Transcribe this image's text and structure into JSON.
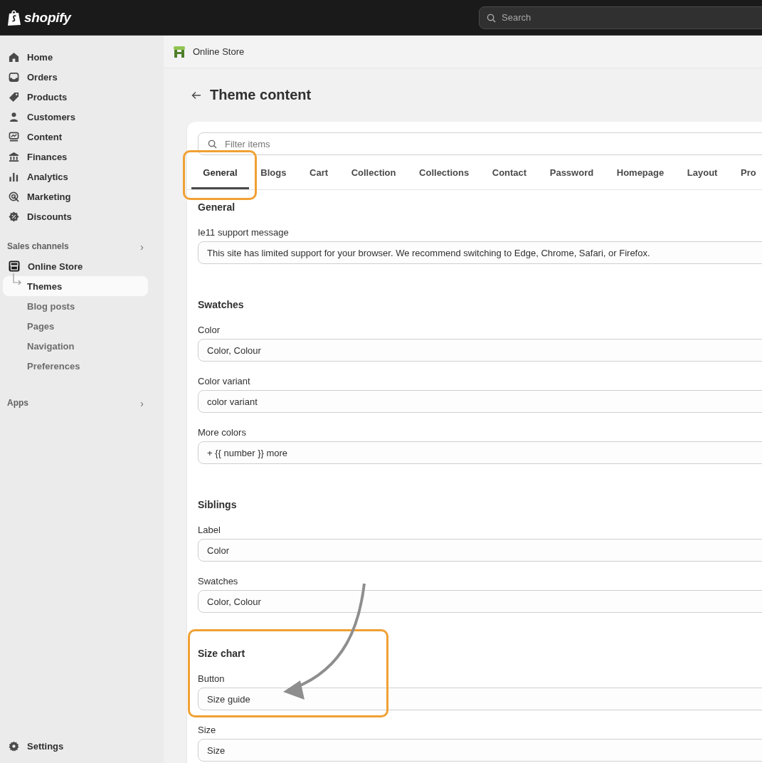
{
  "topbar": {
    "logo_text": "shopify",
    "search": {
      "placeholder": "Search"
    }
  },
  "sidebar": {
    "items": [
      {
        "label": "Home",
        "selected": false
      },
      {
        "label": "Orders",
        "selected": false
      },
      {
        "label": "Products",
        "selected": false
      },
      {
        "label": "Customers",
        "selected": false
      },
      {
        "label": "Content",
        "selected": false
      },
      {
        "label": "Finances",
        "selected": false
      },
      {
        "label": "Analytics",
        "selected": false
      },
      {
        "label": "Marketing",
        "selected": false
      },
      {
        "label": "Discounts",
        "selected": false
      }
    ],
    "sales_channels": {
      "label": "Sales channels",
      "chevron": "›",
      "channel": "Online Store",
      "children": [
        {
          "label": "Themes",
          "selected": true
        },
        {
          "label": "Blog posts",
          "selected": false
        },
        {
          "label": "Pages",
          "selected": false
        },
        {
          "label": "Navigation",
          "selected": false
        },
        {
          "label": "Preferences",
          "selected": false
        }
      ]
    },
    "apps": {
      "label": "Apps",
      "chevron": "›"
    },
    "settings": {
      "label": "Settings"
    }
  },
  "header": {
    "title": "Online Store"
  },
  "page": {
    "title": "Theme content",
    "filter": {
      "placeholder": "Filter items"
    },
    "tabs": [
      {
        "label": "General",
        "selected": true
      },
      {
        "label": "Blogs",
        "selected": false
      },
      {
        "label": "Cart",
        "selected": false
      },
      {
        "label": "Collection",
        "selected": false
      },
      {
        "label": "Collections",
        "selected": false
      },
      {
        "label": "Contact",
        "selected": false
      },
      {
        "label": "Password",
        "selected": false
      },
      {
        "label": "Homepage",
        "selected": false
      },
      {
        "label": "Layout",
        "selected": false
      },
      {
        "label": "Pro",
        "selected": false
      }
    ],
    "sections": [
      {
        "heading": "General",
        "fields": [
          {
            "label": "Ie11 support message",
            "value": "This site has limited support for your browser. We recommend switching to Edge, Chrome, Safari, or Firefox."
          }
        ]
      },
      {
        "heading": "Swatches",
        "fields": [
          {
            "label": "Color",
            "value": "Color, Colour"
          },
          {
            "label": "Color variant",
            "value": "color variant"
          },
          {
            "label": "More colors",
            "value": "+ {{ number }} more"
          }
        ]
      },
      {
        "heading": "Siblings",
        "fields": [
          {
            "label": "Label",
            "value": "Color"
          },
          {
            "label": "Swatches",
            "value": "Color, Colour"
          }
        ]
      },
      {
        "heading": "Size chart",
        "fields": [
          {
            "label": "Button",
            "value": "Size guide"
          },
          {
            "label": "Size",
            "value": "Size"
          }
        ]
      }
    ]
  }
}
